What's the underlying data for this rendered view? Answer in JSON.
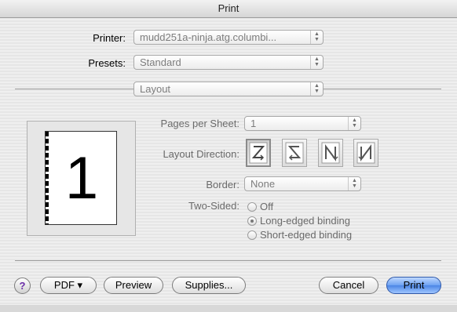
{
  "window": {
    "title": "Print"
  },
  "printer": {
    "label": "Printer:",
    "value": "mudd251a-ninja.atg.columbi..."
  },
  "presets": {
    "label": "Presets:",
    "value": "Standard"
  },
  "panel": {
    "value": "Layout"
  },
  "preview": {
    "page_number": "1"
  },
  "pages_per_sheet": {
    "label": "Pages per Sheet:",
    "value": "1"
  },
  "layout_direction": {
    "label": "Layout Direction:",
    "options": [
      "z-pattern-icon",
      "reverse-z-pattern-icon",
      "n-pattern-icon",
      "reverse-n-pattern-icon"
    ],
    "selected_index": 0
  },
  "border": {
    "label": "Border:",
    "value": "None"
  },
  "two_sided": {
    "label": "Two-Sided:",
    "options": [
      "Off",
      "Long-edged binding",
      "Short-edged binding"
    ],
    "selected": "Long-edged binding"
  },
  "buttons": {
    "help": "?",
    "pdf": "PDF ▾",
    "preview": "Preview",
    "supplies": "Supplies...",
    "cancel": "Cancel",
    "print": "Print"
  },
  "colors": {
    "default_button": "#4b86e6",
    "dim_text": "#6a6a6a"
  }
}
